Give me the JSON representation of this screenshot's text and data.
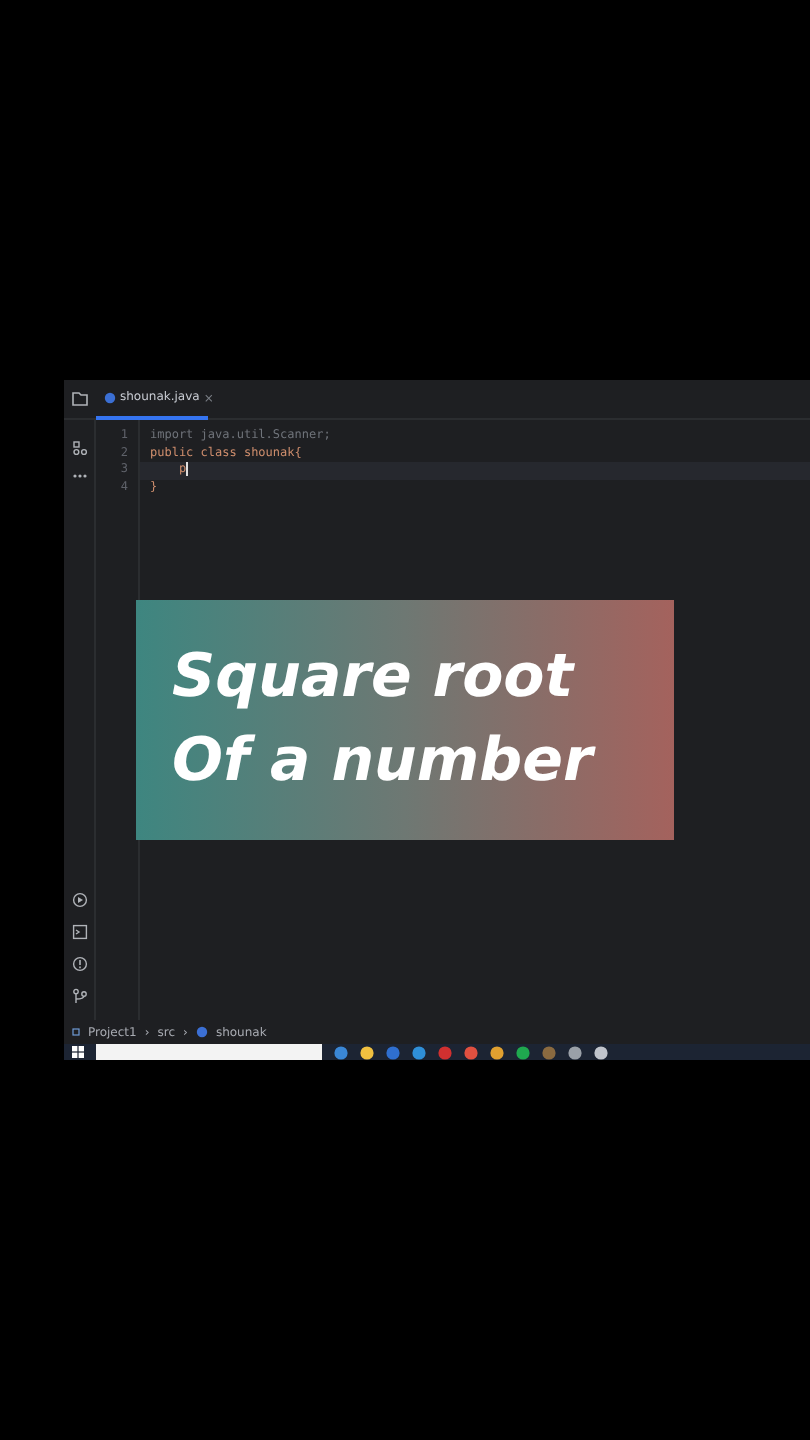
{
  "tab": {
    "label": "shounak.java",
    "close": "×",
    "selected": true
  },
  "code_lines": [
    {
      "number": "1",
      "text": "import java.util.Scanner;",
      "kind": "dim",
      "current": false
    },
    {
      "number": "2",
      "text": "public class shounak{",
      "kind": "code",
      "current": false
    },
    {
      "number": "3",
      "text": "p",
      "kind": "code",
      "current": true
    },
    {
      "number": "4",
      "text": "}",
      "kind": "code",
      "current": false
    }
  ],
  "overlay_title": [
    "Square root",
    "Of a number"
  ],
  "breadcrumb": [
    {
      "label": "Project1",
      "kind": "module"
    },
    {
      "label": "›",
      "kind": "separator"
    },
    {
      "label": "src",
      "kind": "folder"
    },
    {
      "label": "›",
      "kind": "separator"
    },
    {
      "label": "shounak",
      "kind": "class"
    }
  ]
}
